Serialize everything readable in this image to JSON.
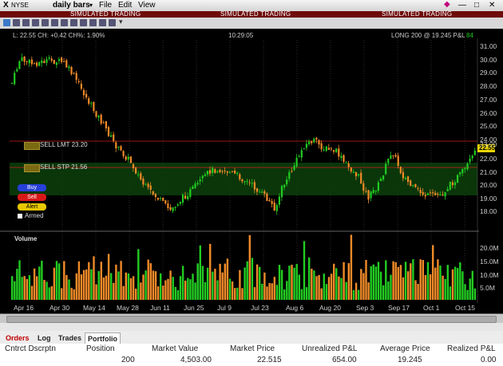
{
  "titlebar": {
    "symbol": "X",
    "exchange": "NYSE",
    "period": "daily bars",
    "menus": [
      "File",
      "Edit",
      "View"
    ]
  },
  "simulated_label": "SIMULATED TRADING",
  "infobar": {
    "quote": "L: 22.55 CH: +0.42 CH%: 1.90%",
    "time": "10:29:05",
    "position": "LONG 200 @ 19.245 P&L",
    "pnl": "84"
  },
  "chart": {
    "price_axis": [
      "31.00",
      "30.00",
      "29.00",
      "28.00",
      "27.00",
      "26.00",
      "25.00",
      "24.00",
      "23.00",
      "22.00",
      "21.00",
      "20.00",
      "19.00",
      "18.00"
    ],
    "volume_axis": [
      "20.0M",
      "15.0M",
      "10.0M",
      "5.0M"
    ],
    "volume_label": "Volume",
    "date_labels": [
      "Apr 16",
      "Apr 30",
      "May 14",
      "May 28",
      "Jun 11",
      "Jun 25",
      "Jul 9",
      "Jul 23",
      "Aug 6",
      "Aug 20",
      "Sep 3",
      "Sep 17",
      "Oct 1",
      "Oct 15"
    ],
    "last_price": "22.55",
    "colors": {
      "up": "#22cc22",
      "down": "#f08a28",
      "limit": "#cc2222",
      "stop": "#cc2222"
    }
  },
  "orders": [
    {
      "label": "SELL LMT 23.20"
    },
    {
      "label": "SELL STP 21.56"
    }
  ],
  "controls": {
    "buy": "Buy",
    "sell": "Sell",
    "alert": "Alert",
    "armed": "Armed"
  },
  "tabs": [
    "Orders",
    "Log",
    "Trades",
    "Portfolio"
  ],
  "portfolio": {
    "headers": [
      "Cntrct Dscrptn",
      "Position",
      "Market Value",
      "Market Price",
      "Unrealized P&L",
      "Average Price",
      "Realized P&L"
    ],
    "row": [
      "",
      "200",
      "4,503.00",
      "22.515",
      "654.00",
      "19.245",
      "0.00"
    ]
  }
}
